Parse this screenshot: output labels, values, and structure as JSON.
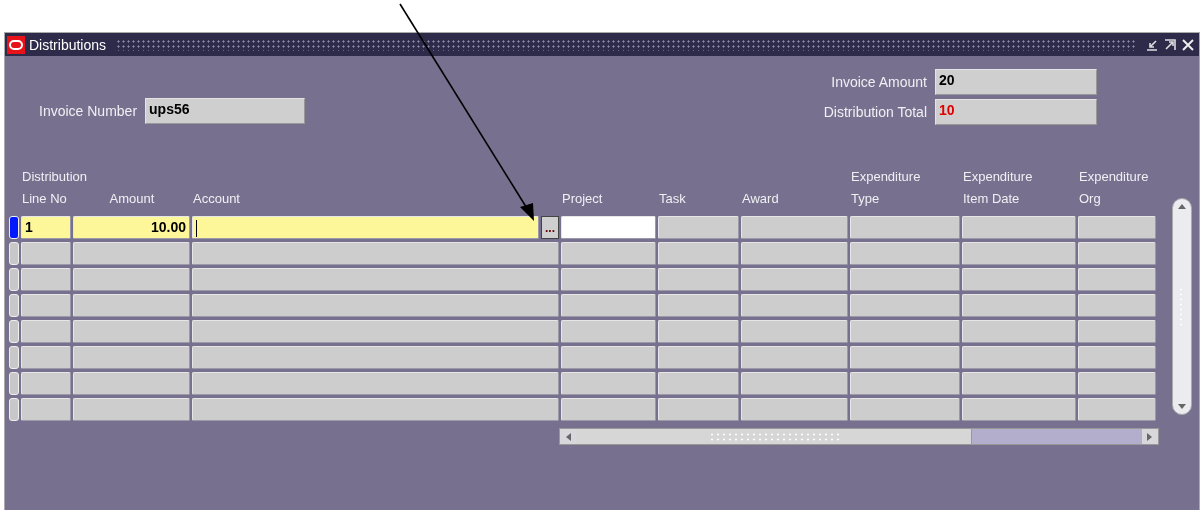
{
  "window": {
    "title": "Distributions"
  },
  "header": {
    "invoice_number": {
      "label": "Invoice Number",
      "value": "ups56"
    },
    "invoice_amount": {
      "label": "Invoice Amount",
      "value": "20",
      "alert": false
    },
    "distribution_total": {
      "label": "Distribution Total",
      "value": "10",
      "alert": true
    }
  },
  "table": {
    "columns": [
      {
        "lines": [
          "Distribution",
          "Line No"
        ],
        "numeric": false
      },
      {
        "lines": [
          "Amount"
        ],
        "numeric": true
      },
      {
        "lines": [
          "Account"
        ],
        "numeric": false
      },
      {
        "lines": [
          "Project"
        ],
        "numeric": false
      },
      {
        "lines": [
          "Task"
        ],
        "numeric": false
      },
      {
        "lines": [
          "Award"
        ],
        "numeric": false
      },
      {
        "lines": [
          "Expenditure",
          "Type"
        ],
        "numeric": false
      },
      {
        "lines": [
          "Expenditure",
          "Item Date"
        ],
        "numeric": false
      },
      {
        "lines": [
          "Expenditure",
          "Org"
        ],
        "numeric": false
      }
    ],
    "rows": [
      {
        "selected": true,
        "cells": [
          {
            "kind": "current",
            "value": "1"
          },
          {
            "kind": "current",
            "value": "10.00"
          },
          {
            "kind": "current",
            "focused": true,
            "button": "..."
          },
          {
            "kind": "editable"
          },
          {
            "kind": "plain"
          },
          {
            "kind": "plain"
          },
          {
            "kind": "plain"
          },
          {
            "kind": "plain"
          },
          {
            "kind": "plain"
          }
        ]
      },
      {
        "selected": false
      },
      {
        "selected": false
      },
      {
        "selected": false
      },
      {
        "selected": false
      },
      {
        "selected": false
      },
      {
        "selected": false
      },
      {
        "selected": false
      }
    ]
  }
}
